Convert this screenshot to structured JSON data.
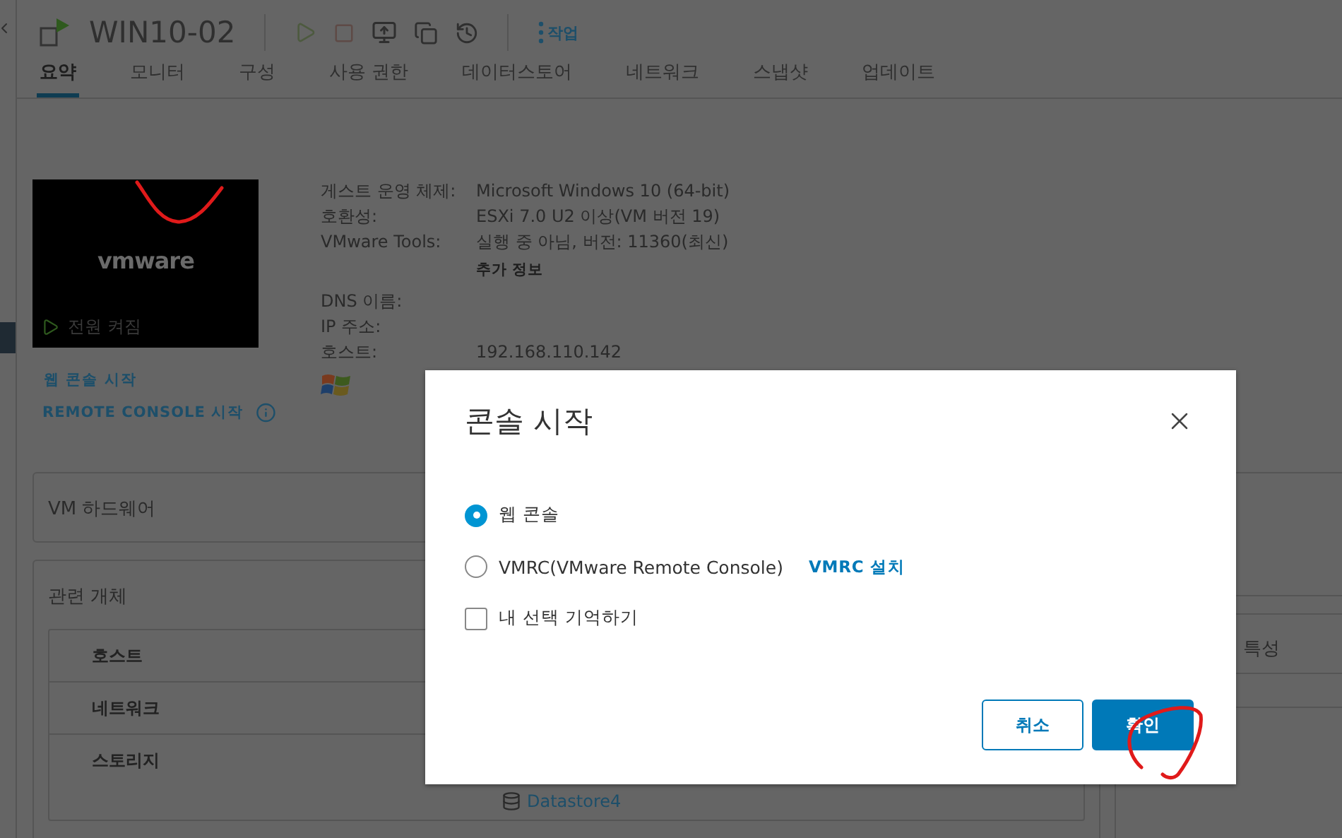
{
  "header": {
    "title": "WIN10-02",
    "actions_label": "작업"
  },
  "tabs": [
    {
      "label": "요약",
      "selected": true
    },
    {
      "label": "모니터",
      "selected": false
    },
    {
      "label": "구성",
      "selected": false
    },
    {
      "label": "사용 권한",
      "selected": false
    },
    {
      "label": "데이터스토어",
      "selected": false
    },
    {
      "label": "네트워크",
      "selected": false
    },
    {
      "label": "스냅샷",
      "selected": false
    },
    {
      "label": "업데이트",
      "selected": false
    }
  ],
  "console_preview": {
    "logo": "vmware",
    "power_state": "전원 켜짐"
  },
  "console_links": [
    "웹 콘솔 시작",
    "REMOTE CONSOLE 시작"
  ],
  "guest_info": [
    {
      "kind": "field",
      "label": "게스트 운영 체제:",
      "value": "Microsoft Windows 10 (64-bit)"
    },
    {
      "kind": "field",
      "label": "호환성:",
      "value": "ESXi 7.0 U2 이상(VM 버전 19)"
    },
    {
      "kind": "field",
      "label": "VMware Tools:",
      "value": "실행 중 아님, 버전: 11360(최신)"
    },
    {
      "kind": "more",
      "value": "추가 정보"
    },
    {
      "kind": "field",
      "label": "DNS 이름:"
    },
    {
      "kind": "field",
      "label": "IP 주소:"
    },
    {
      "kind": "field",
      "label": "호스트:",
      "value": "192.168.110.142"
    }
  ],
  "vm_hardware": {
    "title": "VM 하드웨어"
  },
  "related_objects": {
    "title": "관련 개체",
    "rows": [
      {
        "label": "호스트"
      },
      {
        "label": "네트워크"
      },
      {
        "label": "스토리지",
        "value": "Datastore4"
      }
    ]
  },
  "side_card": {
    "title": "특성"
  },
  "dialog": {
    "title": "콘솔 시작",
    "options": [
      {
        "label": "웹 콘솔",
        "selected": true
      },
      {
        "label": "VMRC(VMware Remote Console)",
        "selected": false,
        "link": "VMRC 설치"
      }
    ],
    "remember": {
      "label": "내 선택 기억하기",
      "checked": false
    },
    "buttons": [
      {
        "label": "취소",
        "kind": "secondary"
      },
      {
        "label": "확인",
        "kind": "primary"
      }
    ]
  }
}
